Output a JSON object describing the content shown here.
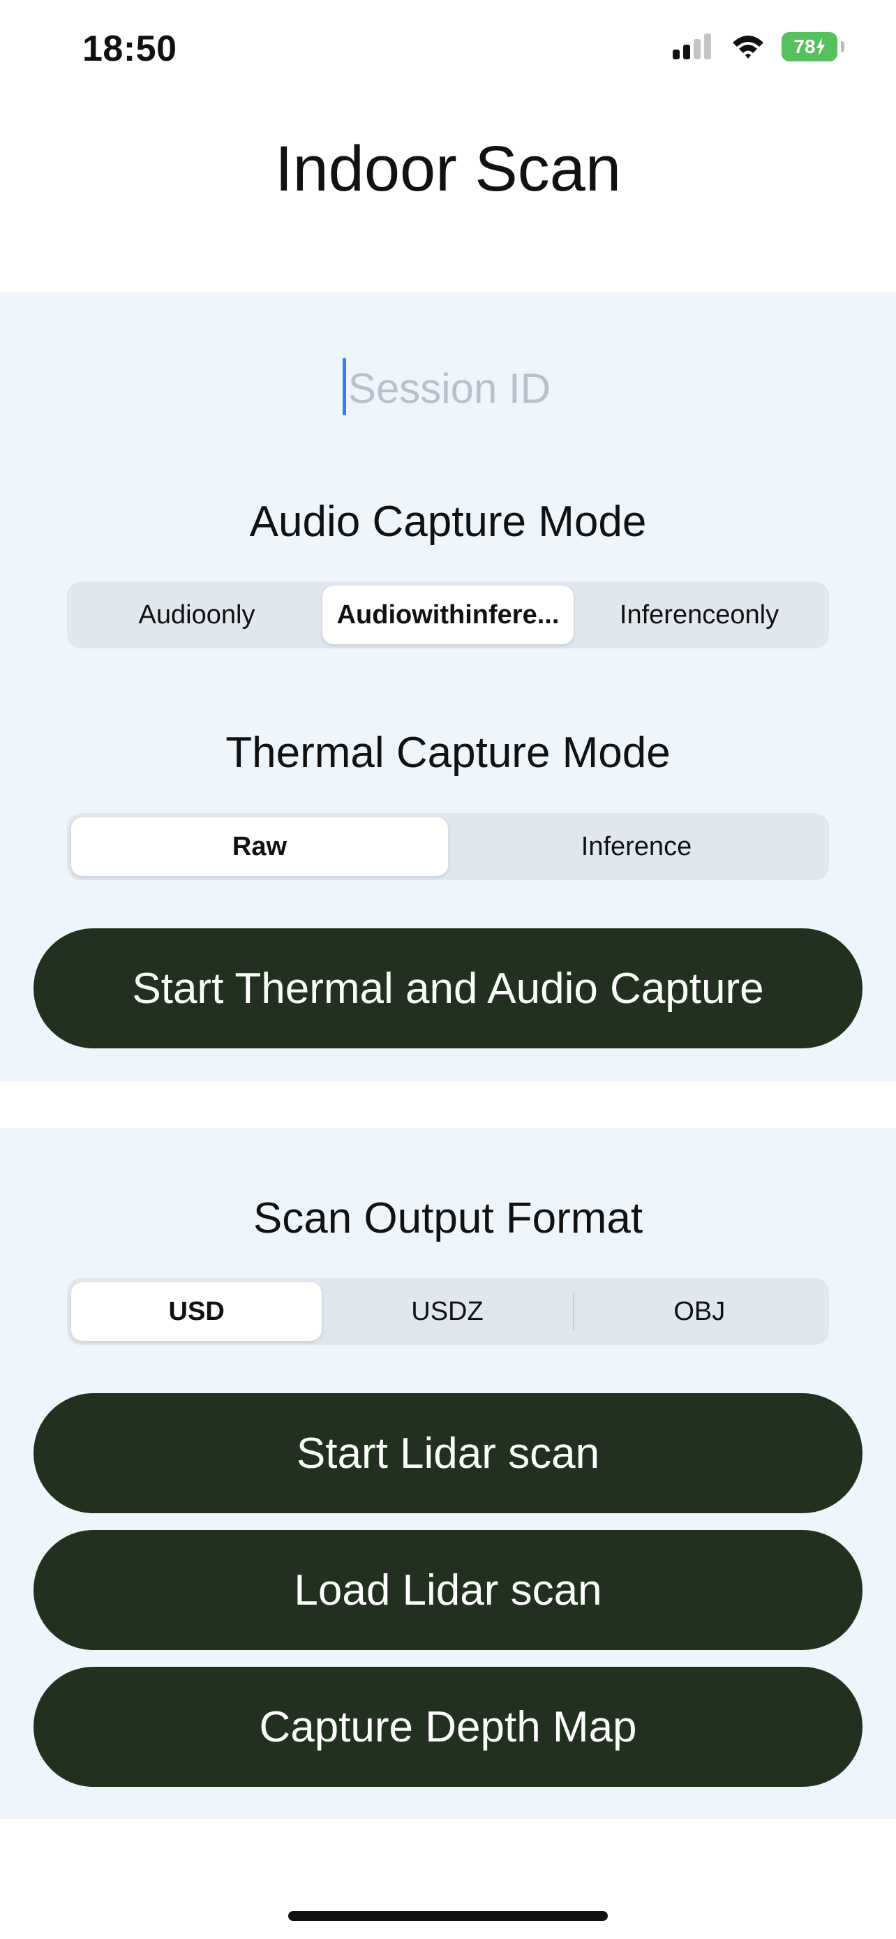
{
  "status_bar": {
    "time": "18:50",
    "battery": "78"
  },
  "title": "Indoor Scan",
  "session": {
    "placeholder": "Session ID",
    "value": ""
  },
  "audio_capture": {
    "heading": "Audio Capture Mode",
    "options": [
      "Audioonly",
      "Audiowithinfere...",
      "Inferenceonly"
    ],
    "selected": "Audiowithinfere..."
  },
  "thermal_capture": {
    "heading": "Thermal Capture Mode",
    "options": [
      "Raw",
      "Inference"
    ],
    "selected": "Raw"
  },
  "start_thermal_audio_label": "Start Thermal and Audio Capture",
  "scan_output": {
    "heading": "Scan Output Format",
    "options": [
      "USD",
      "USDZ",
      "OBJ"
    ],
    "selected": "USD"
  },
  "buttons": {
    "start_lidar": "Start Lidar scan",
    "load_lidar": "Load Lidar scan",
    "capture_depth": "Capture Depth Map"
  },
  "colors": {
    "panel_background": "#eef6fc",
    "button_background": "#22311f",
    "segmented_background": "#e1e7ee",
    "battery_green": "#57c05e",
    "cursor_blue": "#3a7cf0"
  }
}
